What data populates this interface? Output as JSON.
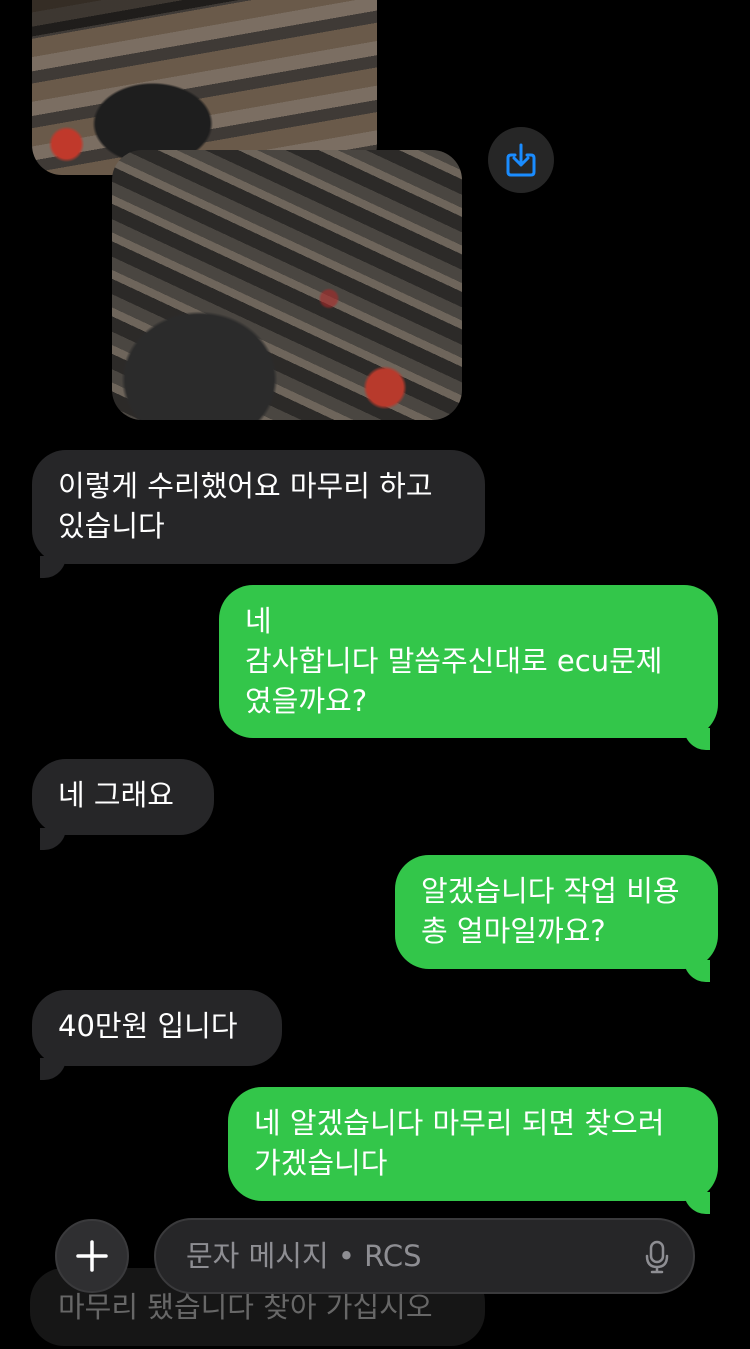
{
  "messages": [
    {
      "dir": "in",
      "text": "이렇게 수리했어요 마무리 하고\n있습니다"
    },
    {
      "dir": "out",
      "text": "네\n감사합니다 말씀주신대로 ecu문제\n였을까요?"
    },
    {
      "dir": "in",
      "text": "네 그래요"
    },
    {
      "dir": "out",
      "text": "알겠습니다 작업 비용\n총 얼마일까요?"
    },
    {
      "dir": "in",
      "text": "40만원 입니다"
    },
    {
      "dir": "out",
      "text": "네 알겠습니다 마무리 되면 찾으러\n가겠습니다"
    }
  ],
  "partial_message": "마무리 됐습니다 찾아 가십시오",
  "input": {
    "placeholder": "문자 메시지 • RCS"
  },
  "icons": {
    "save": "save-to-device-icon",
    "plus": "plus-icon",
    "mic": "microphone-icon"
  },
  "colors": {
    "incoming": "#262628",
    "outgoing": "#33c64a",
    "accent": "#1a8cff"
  }
}
